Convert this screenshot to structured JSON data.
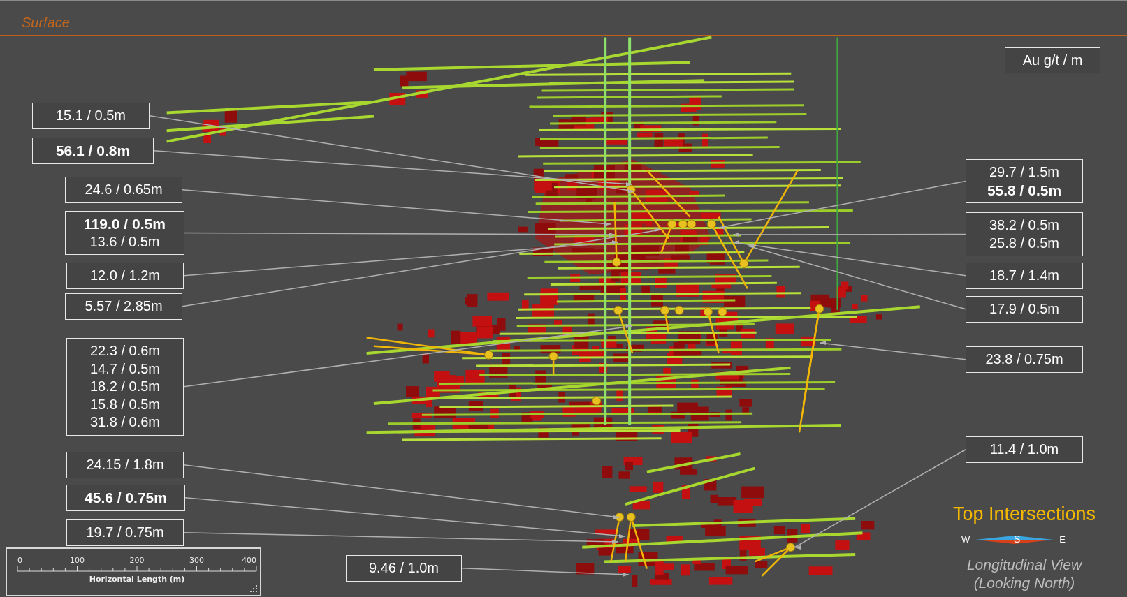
{
  "surface_label": "Surface",
  "legend_title": "Au g/t / m",
  "intersections": [
    {
      "lines": [
        {
          "text": "15.1 / 0.5m",
          "bold": false
        }
      ]
    },
    {
      "lines": [
        {
          "text": "56.1 / 0.8m",
          "bold": true
        }
      ]
    },
    {
      "lines": [
        {
          "text": "24.6 / 0.65m",
          "bold": false
        }
      ]
    },
    {
      "lines": [
        {
          "text": "119.0 / 0.5m",
          "bold": true
        },
        {
          "text": "13.6 / 0.5m",
          "bold": false
        }
      ]
    },
    {
      "lines": [
        {
          "text": "12.0 / 1.2m",
          "bold": false
        }
      ]
    },
    {
      "lines": [
        {
          "text": "5.57 / 2.85m",
          "bold": false
        }
      ]
    },
    {
      "lines": [
        {
          "text": "22.3 / 0.6m",
          "bold": false
        },
        {
          "text": "14.7 / 0.5m",
          "bold": false
        },
        {
          "text": "18.2 / 0.5m",
          "bold": false
        },
        {
          "text": "15.8 / 0.5m",
          "bold": false
        },
        {
          "text": "31.8 / 0.6m",
          "bold": false
        }
      ]
    },
    {
      "lines": [
        {
          "text": "24.15 / 1.8m",
          "bold": false
        }
      ]
    },
    {
      "lines": [
        {
          "text": "45.6 / 0.75m",
          "bold": true
        }
      ]
    },
    {
      "lines": [
        {
          "text": "19.7 / 0.75m",
          "bold": false
        }
      ]
    },
    {
      "lines": [
        {
          "text": "9.46 / 1.0m",
          "bold": false
        }
      ]
    },
    {
      "lines": [
        {
          "text": "29.7 / 1.5m",
          "bold": false
        },
        {
          "text": "55.8 / 0.5m",
          "bold": true
        }
      ]
    },
    {
      "lines": [
        {
          "text": "38.2 / 0.5m",
          "bold": false
        },
        {
          "text": "25.8 / 0.5m",
          "bold": false
        }
      ]
    },
    {
      "lines": [
        {
          "text": "18.7 / 1.4m",
          "bold": false
        }
      ]
    },
    {
      "lines": [
        {
          "text": "17.9 / 0.5m",
          "bold": false
        }
      ]
    },
    {
      "lines": [
        {
          "text": "23.8 / 0.75m",
          "bold": false
        }
      ]
    },
    {
      "lines": [
        {
          "text": "11.4 / 1.0m",
          "bold": false
        }
      ]
    }
  ],
  "scale_bar": {
    "ticks": [
      "0",
      "100",
      "200",
      "300",
      "400"
    ],
    "label": "Horizontal Length (m)"
  },
  "title": "Top Intersections",
  "compass": {
    "west": "W",
    "south": "S",
    "east": "E"
  },
  "view_lines": [
    "Longitudinal View",
    "(Looking North)"
  ]
}
